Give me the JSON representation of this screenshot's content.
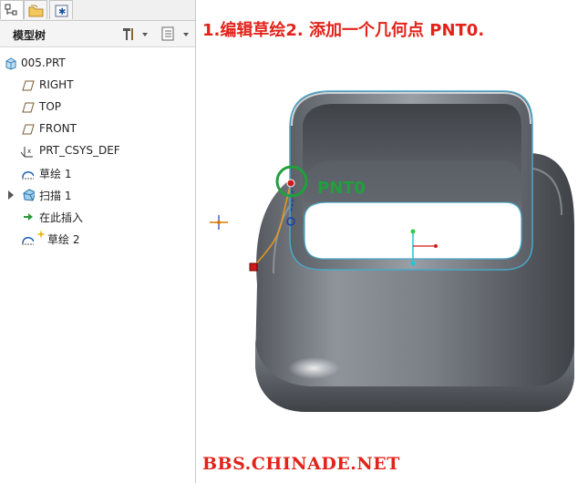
{
  "instruction": "1.编辑草绘2. 添加一个几何点 PNT0.",
  "point_label": "PNT0",
  "watermark": "BBS.CHINADE.NET",
  "panel": {
    "title": "模型树",
    "items": [
      {
        "label": "005.PRT",
        "icon": "part-icon"
      },
      {
        "label": "RIGHT",
        "icon": "datum-plane-icon"
      },
      {
        "label": "TOP",
        "icon": "datum-plane-icon"
      },
      {
        "label": "FRONT",
        "icon": "datum-plane-icon"
      },
      {
        "label": "PRT_CSYS_DEF",
        "icon": "coordinate-system-icon"
      },
      {
        "label": "草绘 1",
        "icon": "sketch-icon"
      },
      {
        "label": "扫描 1",
        "icon": "sweep-icon"
      },
      {
        "label": "在此插入",
        "icon": "insert-here-icon"
      },
      {
        "label": "草绘 2",
        "icon": "sketch-icon"
      }
    ]
  },
  "colors": {
    "instruction": "#e2231a",
    "point_highlight": "#1fa03c",
    "model": "#6e7580"
  }
}
